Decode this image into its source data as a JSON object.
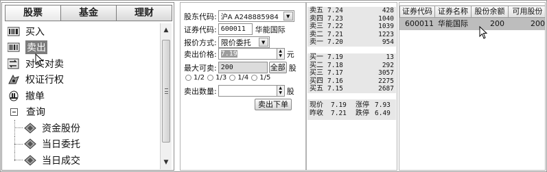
{
  "tabs": [
    "股票",
    "基金",
    "理财"
  ],
  "tree": {
    "items": [
      {
        "label": "买入",
        "icon": "buy-icon"
      },
      {
        "label": "卖出",
        "icon": "sell-icon"
      },
      {
        "label": "对买对卖",
        "icon": "swap-icon"
      },
      {
        "label": "权证行权",
        "icon": "warrant-icon"
      },
      {
        "label": "撤单",
        "icon": "cancel-order-icon"
      }
    ],
    "query": {
      "label": "查询"
    },
    "subitems": [
      {
        "label": "资金股份"
      },
      {
        "label": "当日委托"
      },
      {
        "label": "当日成交"
      }
    ]
  },
  "form": {
    "account_label": "股东代码:",
    "account_value": "沪A A248885984",
    "code_label": "证券代码:",
    "code_value": "600011",
    "stock_name": "华能国际",
    "method_label": "报价方式:",
    "method_value": "限价委托",
    "price_label": "卖出价格:",
    "price_value": "7.19",
    "price_unit": "元",
    "max_label": "最大可卖:",
    "max_value": "200",
    "all_button": "全部",
    "max_unit": "股",
    "ratios": [
      "1/2",
      "1/3",
      "1/4",
      "1/5"
    ],
    "qty_label": "卖出数量:",
    "qty_value": "",
    "qty_unit": "股",
    "submit_label": "卖出下单"
  },
  "quote": {
    "sell": [
      {
        "name": "卖五",
        "price": "7.24",
        "vol": "428"
      },
      {
        "name": "卖四",
        "price": "7.23",
        "vol": "1040"
      },
      {
        "name": "卖三",
        "price": "7.22",
        "vol": "1039"
      },
      {
        "name": "卖二",
        "price": "7.21",
        "vol": "1223"
      },
      {
        "name": "卖一",
        "price": "7.20",
        "vol": "954"
      }
    ],
    "buy": [
      {
        "name": "买一",
        "price": "7.19",
        "vol": "13"
      },
      {
        "name": "买二",
        "price": "7.18",
        "vol": "292"
      },
      {
        "name": "买三",
        "price": "7.17",
        "vol": "3057"
      },
      {
        "name": "买四",
        "price": "7.16",
        "vol": "2275"
      },
      {
        "name": "买五",
        "price": "7.15",
        "vol": "2687"
      }
    ],
    "summary": {
      "now_label": "现价",
      "now_value": "7.19",
      "up_label": "涨停",
      "up_value": "7.93",
      "prev_label": "昨收",
      "prev_value": "7.21",
      "down_label": "跌停",
      "down_value": "6.49"
    }
  },
  "holdings": {
    "headers": [
      "证券代码",
      "证券名称",
      "股份余额",
      "可用股份"
    ],
    "row": {
      "code": "600011",
      "name": "华能国际",
      "balance": "200",
      "available": "200"
    }
  }
}
